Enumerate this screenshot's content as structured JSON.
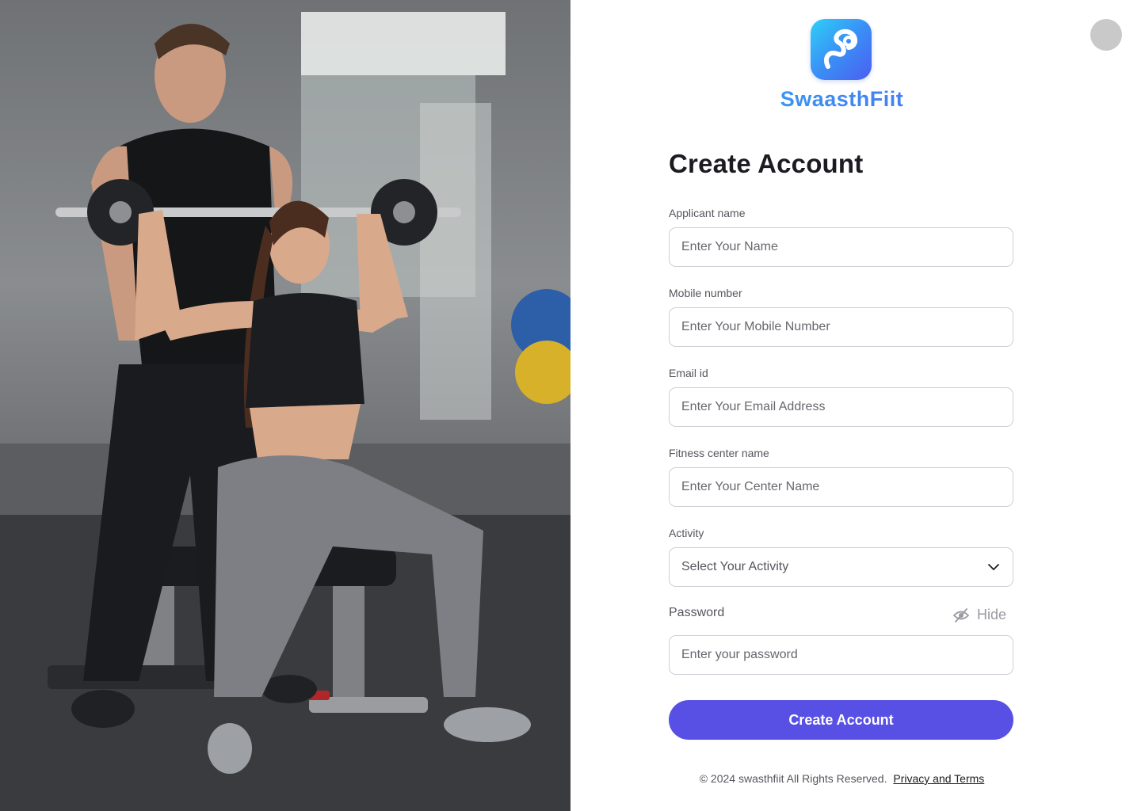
{
  "hero": {
    "alt": "Trainer spotting woman lifting a barbell overhead on a gym bench"
  },
  "brand": {
    "name": "SwaasthFiit",
    "logo_icon": "swaasthfiit-logo-icon"
  },
  "profile": {
    "icon": "avatar-placeholder"
  },
  "form": {
    "title": "Create Account",
    "fields": {
      "name": {
        "label": "Applicant name",
        "placeholder": "Enter Your Name"
      },
      "mobile": {
        "label": "Mobile number",
        "placeholder": "Enter Your Mobile Number"
      },
      "email": {
        "label": "Email id",
        "placeholder": "Enter Your Email Address"
      },
      "center": {
        "label": "Fitness center name",
        "placeholder": "Enter Your Center Name"
      },
      "activity": {
        "label": "Activity",
        "placeholder": "Select Your Activity"
      },
      "password": {
        "label": "Password",
        "placeholder": "Enter your password",
        "toggle_label": "Hide"
      }
    },
    "submit_label": "Create Account"
  },
  "footer": {
    "copyright": "© 2024 swasthfiit All Rights Reserved.",
    "link_label": "Privacy and Terms"
  },
  "colors": {
    "primary": "#5850e4",
    "brand_gradient_start": "#29c6f6",
    "brand_gradient_end": "#5a5cf0"
  }
}
